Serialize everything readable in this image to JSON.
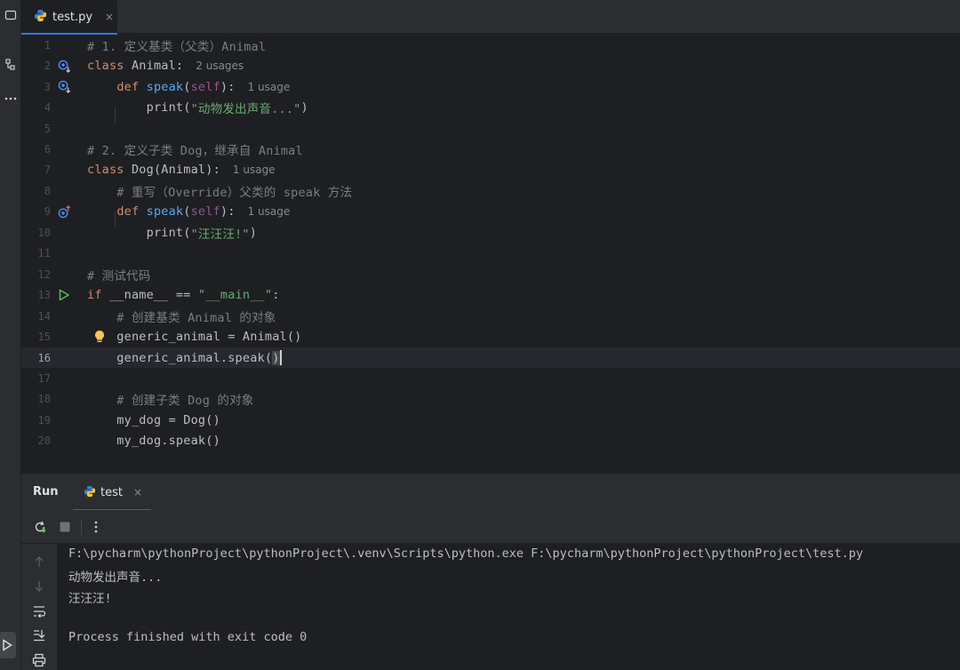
{
  "editor_tab": {
    "filename": "test.py",
    "close": "×"
  },
  "gutter_icons": {
    "implemented": "overridden-by-icon",
    "overrides": "overrides-method-icon",
    "run": "run-icon",
    "bulb": "intention-bulb-icon"
  },
  "code_lines": [
    {
      "n": "1",
      "tokens": [
        [
          "cmt",
          "# 1. 定义基类（父类）Animal"
        ]
      ]
    },
    {
      "n": "2",
      "icon": "overridden-by-icon",
      "tokens": [
        [
          "kw",
          "class "
        ],
        [
          "id",
          "Animal:"
        ]
      ],
      "hint": "2 usages"
    },
    {
      "n": "3",
      "icon": "overridden-by-icon",
      "tokens": [
        [
          "id",
          "    "
        ],
        [
          "kw",
          "def "
        ],
        [
          "fn",
          "speak"
        ],
        [
          "id",
          "("
        ],
        [
          "self",
          "self"
        ],
        [
          "id",
          "):"
        ]
      ],
      "hint": "1 usage"
    },
    {
      "n": "4",
      "tokens": [
        [
          "id",
          "        print("
        ],
        [
          "str",
          "\"动物发出声音...\""
        ],
        [
          "id",
          ")"
        ]
      ]
    },
    {
      "n": "5",
      "tokens": []
    },
    {
      "n": "6",
      "tokens": [
        [
          "cmt",
          "# 2. 定义子类 Dog，继承自 Animal"
        ]
      ]
    },
    {
      "n": "7",
      "tokens": [
        [
          "kw",
          "class "
        ],
        [
          "id",
          "Dog(Animal):"
        ]
      ],
      "hint": "1 usage"
    },
    {
      "n": "8",
      "tokens": [
        [
          "cmt",
          "    # 重写（Override）父类的 speak 方法"
        ]
      ]
    },
    {
      "n": "9",
      "icon": "overrides-method-icon",
      "tokens": [
        [
          "id",
          "    "
        ],
        [
          "kw",
          "def "
        ],
        [
          "fn",
          "speak"
        ],
        [
          "id",
          "("
        ],
        [
          "self",
          "self"
        ],
        [
          "id",
          "):"
        ]
      ],
      "hint": "1 usage"
    },
    {
      "n": "10",
      "tokens": [
        [
          "id",
          "        print("
        ],
        [
          "str",
          "\"汪汪汪!\""
        ],
        [
          "id",
          ")"
        ]
      ]
    },
    {
      "n": "11",
      "tokens": []
    },
    {
      "n": "12",
      "tokens": [
        [
          "cmt",
          "# 测试代码"
        ]
      ]
    },
    {
      "n": "13",
      "icon": "run-icon",
      "tokens": [
        [
          "kw",
          "if "
        ],
        [
          "id",
          "__name__ == "
        ],
        [
          "str",
          "\"__main__\""
        ],
        [
          "id",
          ":"
        ]
      ]
    },
    {
      "n": "14",
      "tokens": [
        [
          "cmt",
          "    # 创建基类 Animal 的对象"
        ]
      ]
    },
    {
      "n": "15",
      "icon": "intention-bulb-icon",
      "tokens": [
        [
          "id",
          "    generic_animal = Animal()"
        ]
      ]
    },
    {
      "n": "16",
      "current": true,
      "tokens": [
        [
          "id",
          "    generic_animal.speak("
        ],
        [
          "paren",
          ")"
        ]
      ]
    },
    {
      "n": "17",
      "tokens": []
    },
    {
      "n": "18",
      "tokens": [
        [
          "cmt",
          "    # 创建子类 Dog 的对象"
        ]
      ]
    },
    {
      "n": "19",
      "tokens": [
        [
          "id",
          "    my_dog = Dog()"
        ]
      ]
    },
    {
      "n": "20",
      "tokens": [
        [
          "id",
          "    my_dog.speak()"
        ]
      ]
    }
  ],
  "run_panel": {
    "title": "Run",
    "tab_label": "test",
    "tab_close": "×",
    "toolbar": {
      "rerun": "rerun-icon",
      "stop": "stop-icon",
      "more": "more-vertical-icon"
    },
    "side": [
      "scroll-up-icon",
      "scroll-down-icon",
      "soft-wrap-icon",
      "scroll-to-end-icon",
      "print-icon"
    ],
    "output": [
      "F:\\pycharm\\pythonProject\\pythonProject\\.venv\\Scripts\\python.exe F:\\pycharm\\pythonProject\\pythonProject\\test.py",
      "动物发出声音...",
      "汪汪汪!",
      "",
      "Process finished with exit code 0"
    ]
  },
  "colors": {
    "background": "#1e1f22",
    "panel": "#2b2d30",
    "keyword": "#cf8e6d",
    "function": "#56a8f5",
    "string": "#6aab73",
    "comment": "#7a7e85",
    "self": "#94558d",
    "accent": "#3574f0"
  }
}
